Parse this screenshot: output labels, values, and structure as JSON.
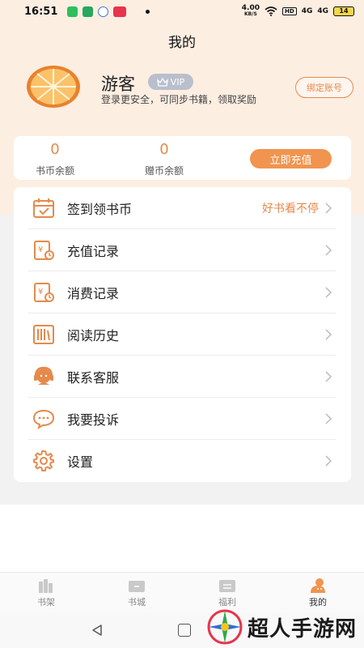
{
  "status_bar": {
    "time": "16:51",
    "net_speed": "4.00",
    "net_unit": "KB/S",
    "hd": "HD",
    "signal": "4G",
    "battery": "14"
  },
  "header": {
    "title": "我的"
  },
  "profile": {
    "name": "游客",
    "vip": "VIP",
    "description": "登录更安全，可同步书籍，领取奖励",
    "bind_label": "绑定账号"
  },
  "balance": {
    "coin_value": "0",
    "coin_label": "书币余额",
    "gift_value": "0",
    "gift_label": "赠币余额",
    "recharge_label": "立即充值"
  },
  "menu": {
    "items": [
      {
        "label": "签到领书币",
        "hint": "好书看不停",
        "icon": "calendar-icon"
      },
      {
        "label": "充值记录",
        "hint": "",
        "icon": "recharge-record-icon"
      },
      {
        "label": "消费记录",
        "hint": "",
        "icon": "consumption-record-icon"
      },
      {
        "label": "阅读历史",
        "hint": "",
        "icon": "book-history-icon"
      },
      {
        "label": "联系客服",
        "hint": "",
        "icon": "headset-icon"
      },
      {
        "label": "我要投诉",
        "hint": "",
        "icon": "chat-bubble-icon"
      },
      {
        "label": "设置",
        "hint": "",
        "icon": "gear-icon"
      }
    ]
  },
  "bottom_nav": {
    "items": [
      {
        "label": "书架",
        "icon": "bookshelf-icon"
      },
      {
        "label": "书城",
        "icon": "bookstore-icon"
      },
      {
        "label": "福利",
        "icon": "welfare-icon"
      },
      {
        "label": "我的",
        "icon": "profile-icon",
        "active": true
      }
    ]
  },
  "watermark": {
    "text": "超人手游网"
  },
  "colors": {
    "accent": "#e48a4c",
    "button": "#f0944f",
    "header_bg": "#fdeee2",
    "vip_badge": "#b9bfcc"
  }
}
